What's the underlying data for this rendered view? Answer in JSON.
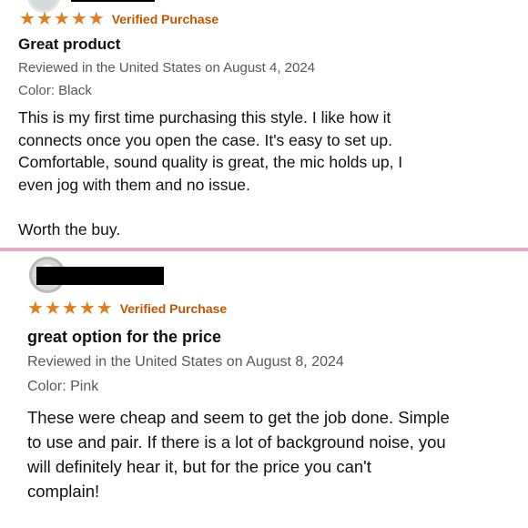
{
  "reviews": [
    {
      "stars": 5,
      "verified": "Verified Purchase",
      "title": "Great product",
      "reviewed": "Reviewed in the United States on August 4, 2024",
      "color": "Color: Black",
      "body_lines": [
        "This is my first time purchasing this style. I like how it",
        "connects once you open the case. It's easy to set up.",
        "Comfortable, sound quality is great, the mic holds up, I",
        "even jog with them and no issue."
      ],
      "body_end": "Worth the buy."
    },
    {
      "stars": 5,
      "verified": "Verified Purchase",
      "title": "great option for the price",
      "reviewed": "Reviewed in the United States on August 8, 2024",
      "color": "Color: Pink",
      "body_lines": [
        "These were cheap and seem to get the job done. Simple",
        "to use and pair. If there is a lot of background noise, you",
        "will definitely hear it, but for the price you can't",
        "complain!"
      ]
    }
  ],
  "colors": {
    "star": "#e07f1f",
    "verified": "#c45500",
    "divider": "#e6a9c6"
  }
}
